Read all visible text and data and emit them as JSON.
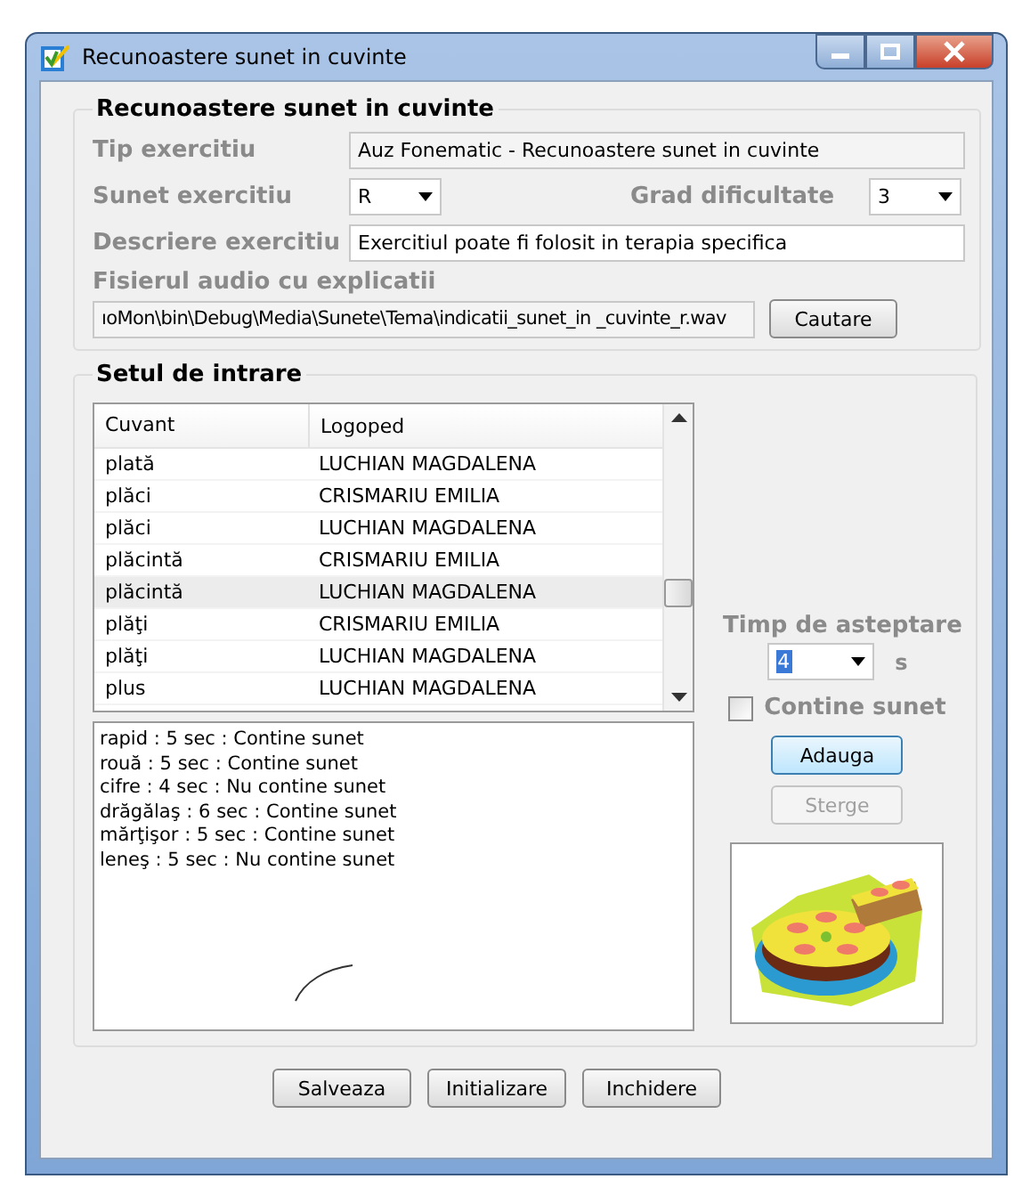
{
  "window": {
    "title": "Recunoastere sunet in cuvinte"
  },
  "exercise_group": {
    "title": "Recunoastere sunet in cuvinte",
    "type_label": "Tip exercitiu",
    "type_value": "Auz Fonematic - Recunoastere sunet in cuvinte",
    "sound_label": "Sunet exercitiu",
    "sound_value": "R",
    "difficulty_label": "Grad dificultate",
    "difficulty_value": "3",
    "description_label": "Descriere exercitiu",
    "description_value": "Exercitiul poate fi folosit in terapia specifica",
    "audio_label": "Fisierul audio cu explicatii",
    "audio_value": "ıoMon\\bin\\Debug\\Media\\Sunete\\Tema\\indicatii_sunet_in _cuvinte_r.wav",
    "browse_button": "Cautare"
  },
  "input_group": {
    "title": "Setul de intrare",
    "table": {
      "columns": [
        "Cuvant",
        "Logoped"
      ],
      "rows": [
        {
          "word": "plată",
          "therapist": "LUCHIAN MAGDALENA",
          "selected": false
        },
        {
          "word": "plăci",
          "therapist": "CRISMARIU EMILIA",
          "selected": false
        },
        {
          "word": "plăci",
          "therapist": "LUCHIAN MAGDALENA",
          "selected": false
        },
        {
          "word": "plăcintă",
          "therapist": "CRISMARIU EMILIA",
          "selected": false
        },
        {
          "word": "plăcintă",
          "therapist": "LUCHIAN MAGDALENA",
          "selected": true
        },
        {
          "word": "plăţi",
          "therapist": "CRISMARIU EMILIA",
          "selected": false
        },
        {
          "word": "plăţi",
          "therapist": "LUCHIAN MAGDALENA",
          "selected": false
        },
        {
          "word": "plus",
          "therapist": "LUCHIAN MAGDALENA",
          "selected": false
        }
      ]
    },
    "entries": [
      "rapid : 5 sec : Contine sunet",
      "rouă : 5 sec : Contine sunet",
      "cifre : 4 sec : Nu contine sunet",
      "drăgălaş : 6 sec : Contine sunet",
      "mărţişor : 5 sec : Contine sunet",
      "leneş : 5 sec : Nu contine sunet"
    ],
    "wait_label": "Timp de asteptare",
    "wait_value": "4",
    "wait_unit": "s",
    "contains_sound": {
      "label": "Contine sunet",
      "checked": false
    },
    "add_button": {
      "label": "Adauga",
      "disabled": false
    },
    "delete_button": {
      "label": "Sterge",
      "disabled": true
    }
  },
  "buttons": [
    "Salveaza",
    "Initializare",
    "Inchidere"
  ]
}
